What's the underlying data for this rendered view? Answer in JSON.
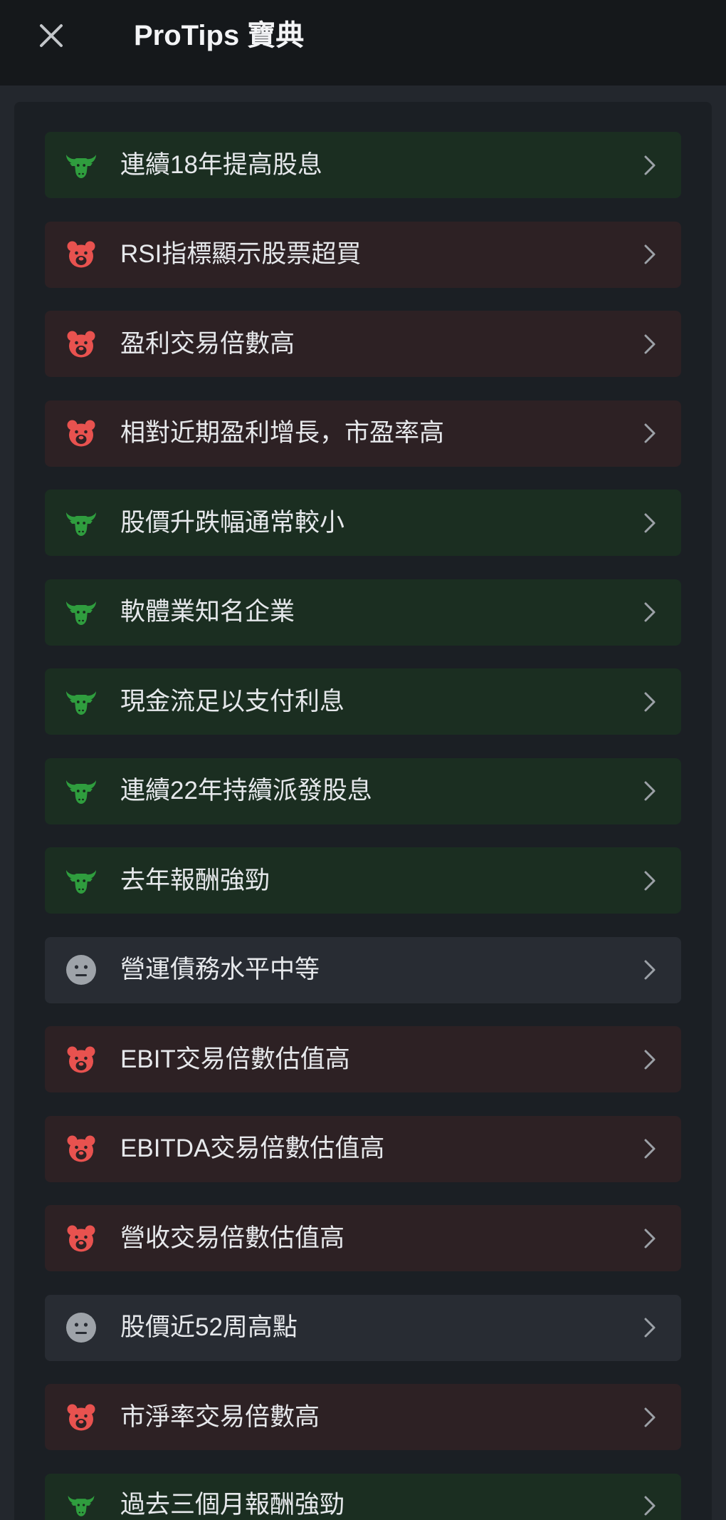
{
  "header": {
    "title": "ProTips 寶典",
    "close_icon": "close-icon"
  },
  "colors": {
    "page_bg": "#23272d",
    "header_bg": "#15181b",
    "panel_bg": "#1b1f24",
    "bull": "#2f9d3e",
    "bear": "#e8524f",
    "neutral": "#9ea3a9",
    "bull_bg": "#1b2e21",
    "bear_bg": "#2d2124",
    "neutral_bg": "#282c33",
    "text": "#e6e8eb",
    "chevron": "#9ca1a7"
  },
  "row_chevron_icon": "chevron-right-icon",
  "tips": [
    {
      "icon": "bull-icon",
      "label": "連續18年提高股息"
    },
    {
      "icon": "bear-icon",
      "label": "RSI指標顯示股票超買"
    },
    {
      "icon": "bear-icon",
      "label": "盈利交易倍數高"
    },
    {
      "icon": "bear-icon",
      "label": "相對近期盈利增長，市盈率高"
    },
    {
      "icon": "bull-icon",
      "label": "股價升跌幅通常較小"
    },
    {
      "icon": "bull-icon",
      "label": "軟體業知名企業"
    },
    {
      "icon": "bull-icon",
      "label": "現金流足以支付利息"
    },
    {
      "icon": "bull-icon",
      "label": "連續22年持續派發股息"
    },
    {
      "icon": "bull-icon",
      "label": "去年報酬強勁"
    },
    {
      "icon": "neutral-face-icon",
      "label": "營運債務水平中等"
    },
    {
      "icon": "bear-icon",
      "label": "EBIT交易倍數估值高"
    },
    {
      "icon": "bear-icon",
      "label": "EBITDA交易倍數估值高"
    },
    {
      "icon": "bear-icon",
      "label": "營收交易倍數估值高"
    },
    {
      "icon": "neutral-face-icon",
      "label": "股價近52周高點"
    },
    {
      "icon": "bear-icon",
      "label": "市淨率交易倍數高"
    },
    {
      "icon": "bull-icon",
      "label": "過去三個月報酬強勁"
    }
  ]
}
